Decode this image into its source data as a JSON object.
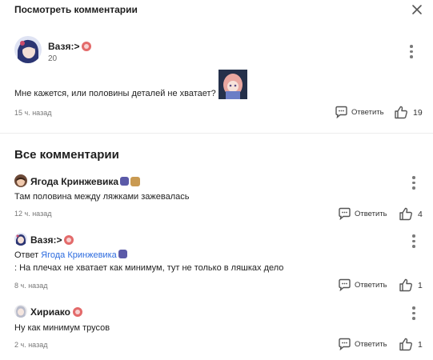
{
  "header": {
    "title": "Посмотреть комментарии"
  },
  "main_comment": {
    "author": "Вазя:>",
    "level": "20",
    "text": "Мне кажется, или половины деталей не хватает?",
    "time": "15 ч. назад",
    "reply_label": "Ответить",
    "likes": "19"
  },
  "all_comments_title": "Все комментарии",
  "comments": [
    {
      "author": "Ягода Кринжевика",
      "text": "Там половина между ляжками зажевалась",
      "time": "12 ч. назад",
      "reply_label": "Ответить",
      "likes": "4"
    },
    {
      "author": "Вазя:>",
      "reply_prefix": "Ответ",
      "reply_to": "Ягода Кринжевика",
      "text": ": На плечах не хватает как минимум, тут не только в ляшках дело",
      "time": "8 ч. назад",
      "reply_label": "Ответить",
      "likes": "1"
    },
    {
      "author": "Хириако",
      "text": "Ну как минимум трусов",
      "time": "2 ч. назад",
      "reply_label": "Ответить",
      "likes": "1"
    }
  ]
}
